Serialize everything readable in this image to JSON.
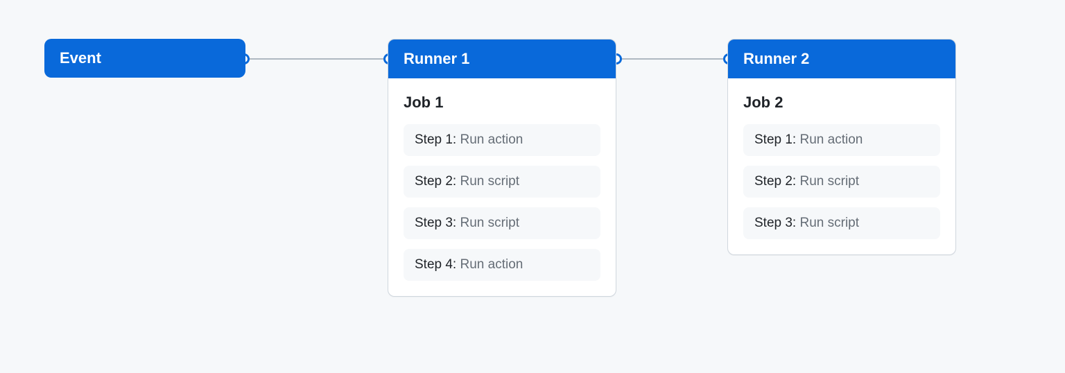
{
  "colors": {
    "accent": "#0969da",
    "bg": "#f6f8fa",
    "border": "#d0d7de",
    "muted": "#656d76"
  },
  "event": {
    "label": "Event"
  },
  "runners": [
    {
      "title": "Runner 1",
      "job": "Job 1",
      "steps": [
        {
          "label": "Step 1:",
          "desc": "Run action"
        },
        {
          "label": "Step 2:",
          "desc": "Run script"
        },
        {
          "label": "Step 3:",
          "desc": "Run script"
        },
        {
          "label": "Step 4:",
          "desc": "Run action"
        }
      ]
    },
    {
      "title": "Runner 2",
      "job": "Job 2",
      "steps": [
        {
          "label": "Step 1:",
          "desc": "Run action"
        },
        {
          "label": "Step 2:",
          "desc": "Run script"
        },
        {
          "label": "Step 3:",
          "desc": "Run script"
        }
      ]
    }
  ]
}
